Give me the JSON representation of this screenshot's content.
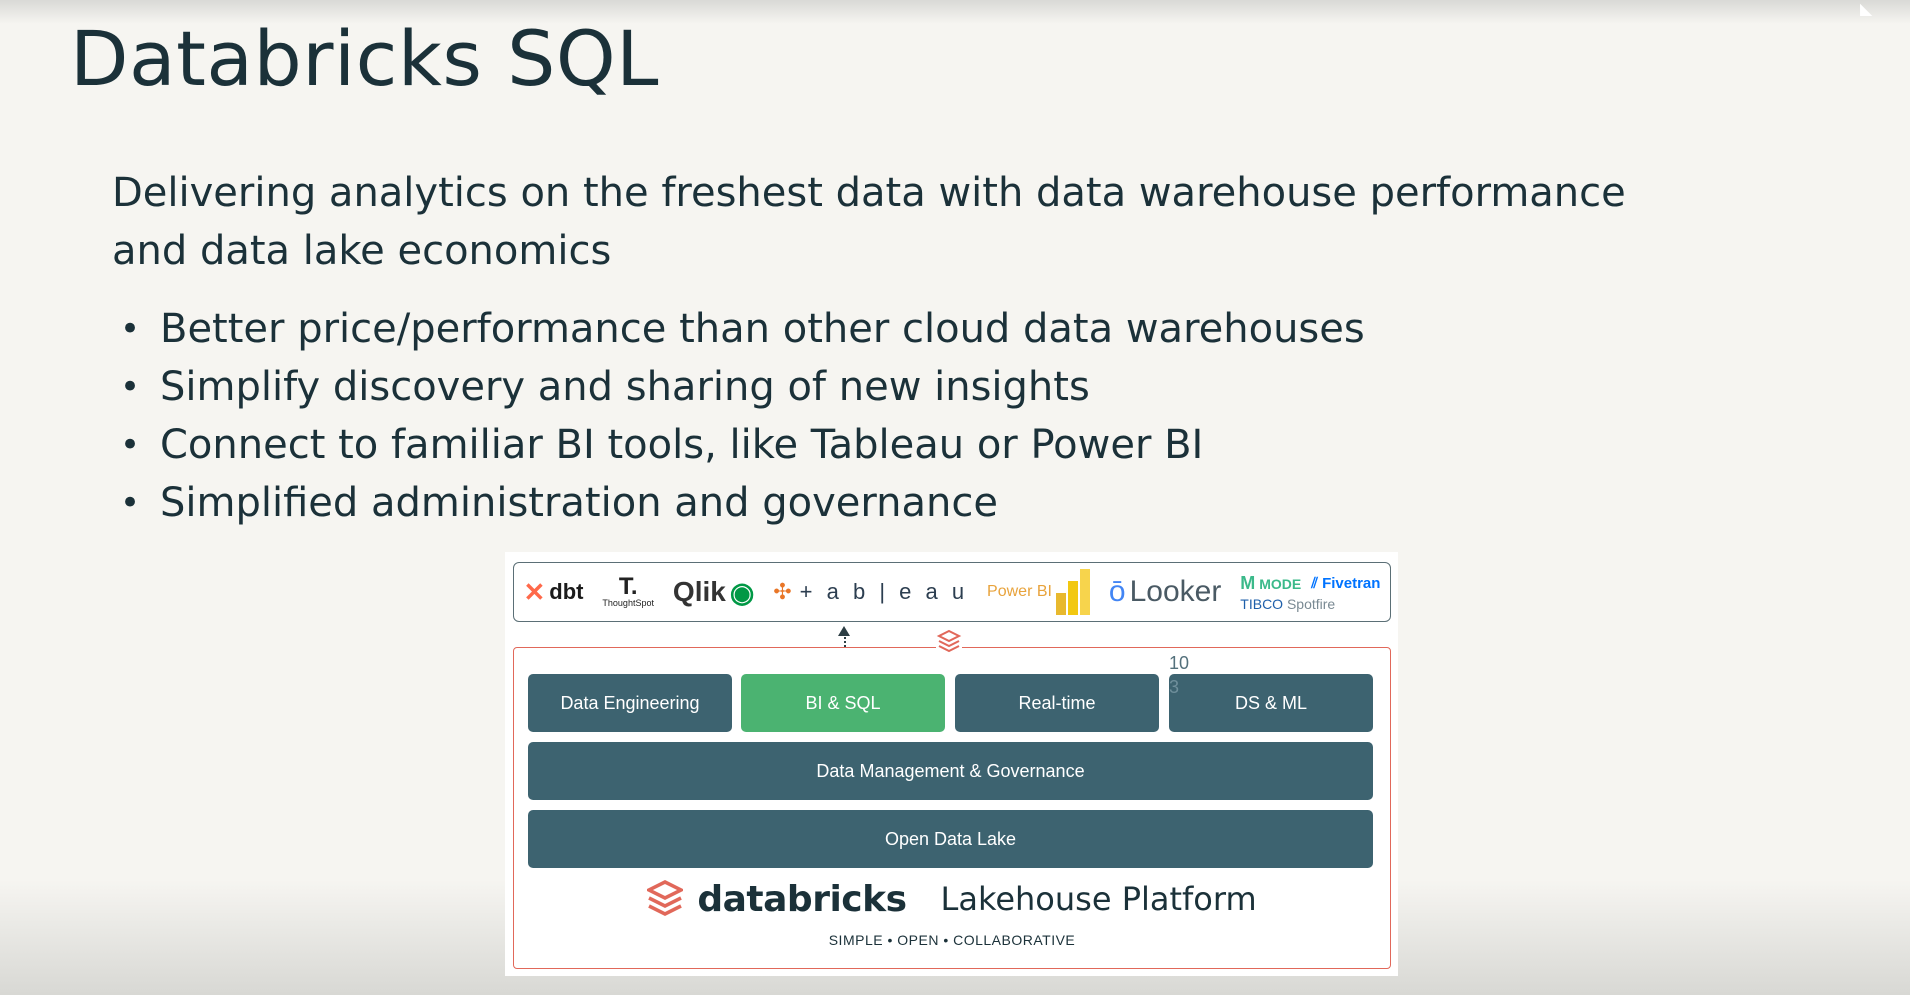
{
  "slide": {
    "title": "Databricks SQL",
    "subtitle": "Delivering analytics on the freshest data with data warehouse performance and data lake economics",
    "bullets": [
      "Better price/performance than other cloud data warehouses",
      "Simplify discovery and sharing of new insights",
      "Connect to familiar BI tools, like Tableau or Power BI",
      "Simplified administration and governance"
    ],
    "bullet_glyph": "•"
  },
  "diagram": {
    "bi_tools": {
      "dbt": "dbt",
      "thoughtspot_mark": "T.",
      "thoughtspot": "ThoughtSpot",
      "qlik": "Qlik",
      "tableau": "+ a b | e a u",
      "powerbi": "Power BI",
      "looker": "Looker",
      "mode": "MODE",
      "fivetran": "Fivetran",
      "tibco": "TIBCO",
      "spotfire": "Spotfire"
    },
    "workloads": [
      "Data Engineering",
      "BI & SQL",
      "Real-time",
      "DS & ML"
    ],
    "stray_digits": [
      "10",
      "3"
    ],
    "governance_layer": "Data Management & Governance",
    "lake_layer": "Open Data Lake",
    "brand_name": "databricks",
    "platform_name": "Lakehouse Platform",
    "tagline": "SIMPLE • OPEN • COLLABORATIVE",
    "colors": {
      "layer": "#3d6370",
      "highlight": "#4bb371",
      "platform_border": "#e1685a",
      "brand_red": "#e1685a"
    },
    "icons": {
      "arrow": "arrow-up-icon",
      "cube": "databricks-cube-icon"
    }
  }
}
